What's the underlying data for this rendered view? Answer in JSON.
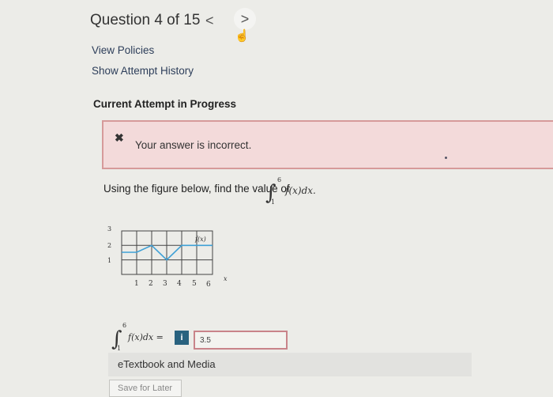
{
  "header": {
    "question_title": "Question 4 of 15",
    "prev_glyph": "<",
    "next_glyph": ">",
    "cursor_icon": "pointer-hand-icon"
  },
  "links": {
    "view_policies": "View Policies",
    "show_history": "Show Attempt History"
  },
  "attempt": {
    "label": "Current Attempt in Progress"
  },
  "feedback": {
    "icon": "close-icon",
    "text": "Your answer is incorrect.",
    "color": "#f3dada",
    "border_color": "#d69a9a"
  },
  "question": {
    "text": "Using the figure below, find the value of",
    "integral": {
      "lower": "1",
      "upper": "6",
      "integrand": "f(x)dx."
    }
  },
  "graph": {
    "y_ticks": [
      "3",
      "2",
      "1"
    ],
    "x_ticks": [
      "1",
      "2",
      "3",
      "4",
      "5",
      "6"
    ],
    "x_axis_label": "x",
    "curve_label": "f(x)"
  },
  "answer": {
    "integral": {
      "lower": "1",
      "upper": "6",
      "integrand": "f(x)dx ="
    },
    "info_label": "i",
    "value": "3.5"
  },
  "etextbook": {
    "label": "eTextbook and Media"
  },
  "save_later": {
    "label": "Save for Later"
  }
}
